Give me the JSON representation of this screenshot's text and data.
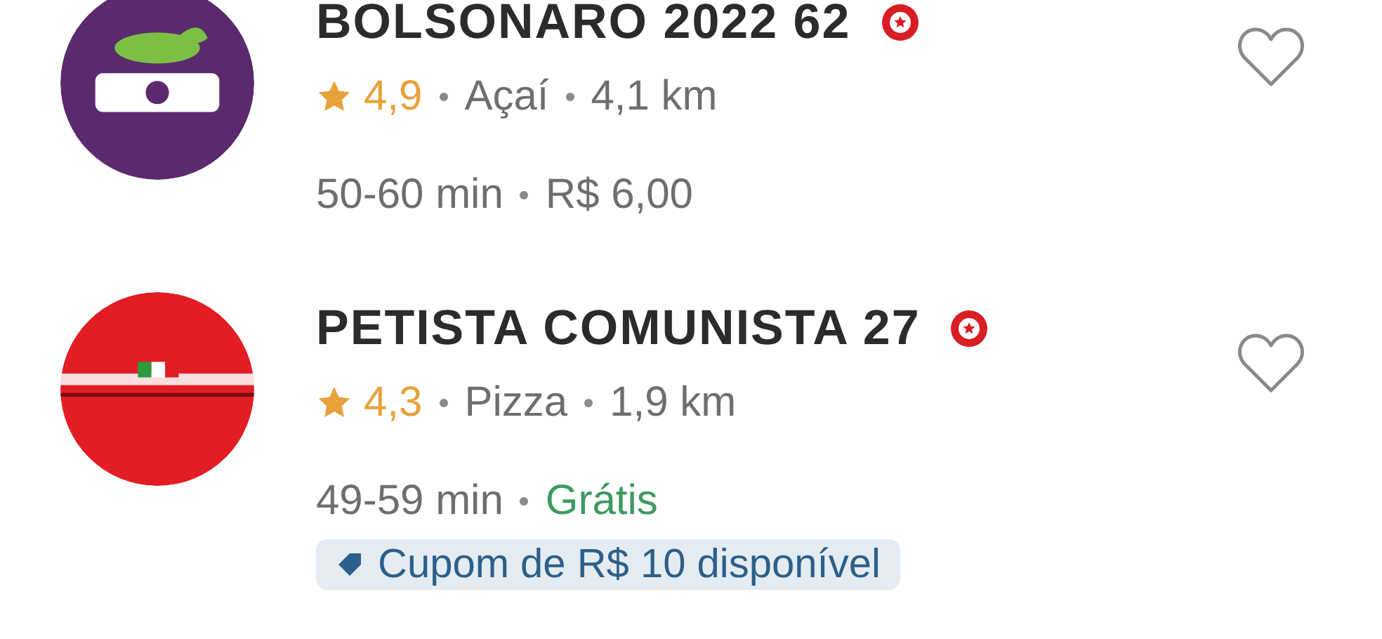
{
  "restaurants": [
    {
      "name": "BOLSONARO 2022 62",
      "badge": true,
      "favorite": false,
      "logo": {
        "color": "#5b2a6e"
      },
      "rating": "4,9",
      "category": "Açaí",
      "distance": "4,1 km",
      "time": "50-60 min",
      "fee": "R$ 6,00",
      "free": false
    },
    {
      "name": "PETISTA COMUNISTA 27",
      "badge": true,
      "favorite": false,
      "logo": {
        "color": "#e21d24"
      },
      "rating": "4,3",
      "category": "Pizza",
      "distance": "1,9 km",
      "time": "49-59 min",
      "fee": "Grátis",
      "free": true,
      "coupon": "Cupom de R$ 10 disponível"
    }
  ]
}
